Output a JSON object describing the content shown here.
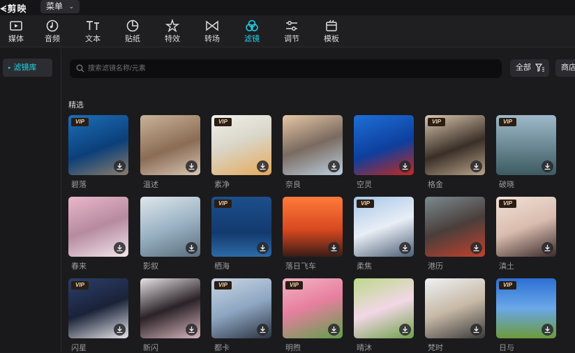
{
  "app": {
    "logo": "剪映",
    "menu_label": "菜单"
  },
  "toolbar": {
    "tabs": [
      {
        "label": "媒体",
        "icon": "media-icon"
      },
      {
        "label": "音频",
        "icon": "audio-icon"
      },
      {
        "label": "文本",
        "icon": "text-icon"
      },
      {
        "label": "贴纸",
        "icon": "sticker-icon"
      },
      {
        "label": "特效",
        "icon": "effects-icon"
      },
      {
        "label": "转场",
        "icon": "transition-icon"
      },
      {
        "label": "滤镜",
        "icon": "filter-icon",
        "active": true
      },
      {
        "label": "调节",
        "icon": "adjust-icon"
      },
      {
        "label": "模板",
        "icon": "template-icon"
      }
    ]
  },
  "sidebar": {
    "items": [
      {
        "label": "滤镜库",
        "active": true
      }
    ]
  },
  "search": {
    "placeholder": "搜索滤镜名称/元素",
    "value": ""
  },
  "filter": {
    "label": "全部"
  },
  "shop": {
    "label": "商店"
  },
  "section": {
    "title": "精选"
  },
  "grid": {
    "items": [
      {
        "name": "碧落",
        "vip": true,
        "vip_label": "VIP",
        "bg": "linear-gradient(160deg,#1d6fb8,#0b3f7a 55%,#8a7d6b)"
      },
      {
        "name": "温述",
        "vip": false,
        "bg": "linear-gradient(160deg,#c9b399,#8b6c55 55%,#d8c7b3)"
      },
      {
        "name": "素净",
        "vip": true,
        "vip_label": "VIP",
        "bg": "linear-gradient(160deg,#f2f0ea,#d9d6c9 45%,#e6a95a)"
      },
      {
        "name": "奈良",
        "vip": false,
        "bg": "linear-gradient(160deg,#e7c7a6,#7a6a60 50%,#bcd0e0)"
      },
      {
        "name": "空灵",
        "vip": false,
        "bg": "linear-gradient(160deg,#1e6fd6,#0d3f9e 55%,#c7281e)"
      },
      {
        "name": "格金",
        "vip": true,
        "vip_label": "VIP",
        "bg": "linear-gradient(160deg,#d9c7ad,#3a2f28 55%,#b9a48a)"
      },
      {
        "name": "破晓",
        "vip": true,
        "vip_label": "VIP",
        "bg": "linear-gradient(180deg,#9fb9c9,#6d8a96 50%,#3c5a5f)"
      },
      {
        "name": "春来",
        "vip": false,
        "bg": "linear-gradient(160deg,#e9b8c8,#b68aa0 50%,#f2e6ec)"
      },
      {
        "name": "影叙",
        "vip": false,
        "bg": "linear-gradient(160deg,#dfe6ec,#9bb3c4 50%,#5a6e7c)"
      },
      {
        "name": "栖海",
        "vip": true,
        "vip_label": "VIP",
        "bg": "linear-gradient(180deg,#1d4f8c,#123a6e 60%,#2e6aa8)"
      },
      {
        "name": "落日飞车",
        "vip": false,
        "bg": "linear-gradient(180deg,#ff7b3a,#d8481f 55%,#3a1c18)"
      },
      {
        "name": "柔焦",
        "vip": true,
        "vip_label": "VIP",
        "bg": "linear-gradient(160deg,#a7c6e6,#e8eef6 50%,#4d5e74)"
      },
      {
        "name": "港历",
        "vip": false,
        "bg": "linear-gradient(160deg,#7b8a8f,#4a3e3b 50%,#c2412d)"
      },
      {
        "name": "滇土",
        "vip": true,
        "vip_label": "VIP",
        "bg": "linear-gradient(160deg,#f1e1d8,#d9bcae 50%,#3a2a2a)"
      },
      {
        "name": "闪星",
        "vip": true,
        "vip_label": "VIP",
        "bg": "linear-gradient(160deg,#2b3f6b,#1a2238 50%,#e6e6ea)"
      },
      {
        "name": "新闪",
        "vip": false,
        "bg": "linear-gradient(160deg,#e6e2e6,#2a2226 50%,#d8b6bf)"
      },
      {
        "name": "都卡",
        "vip": true,
        "vip_label": "VIP",
        "bg": "linear-gradient(160deg,#c8d6e4,#8ea6c2 50%,#2c3442)"
      },
      {
        "name": "明煦",
        "vip": true,
        "vip_label": "VIP",
        "bg": "linear-gradient(160deg,#f3b3c4,#e77f9f 45%,#5fa04a)"
      },
      {
        "name": "晴沐",
        "vip": false,
        "bg": "linear-gradient(160deg,#bcd98a,#f2d7e6 50%,#6fa14a)"
      },
      {
        "name": "梵时",
        "vip": false,
        "bg": "linear-gradient(160deg,#eef1f4,#c7b9a6 50%,#3a3a3a)"
      },
      {
        "name": "日与",
        "vip": true,
        "vip_label": "VIP",
        "bg": "linear-gradient(180deg,#2c6fd4,#6aa8e8 50%,#6b9a3a)"
      }
    ]
  }
}
